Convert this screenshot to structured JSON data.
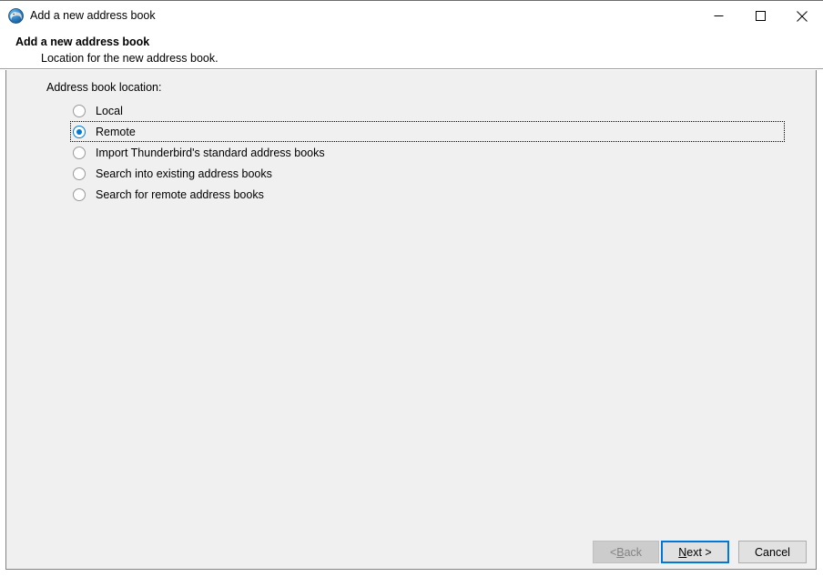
{
  "window": {
    "title": "Add a new address book",
    "icon": "thunderbird-icon",
    "controls": {
      "minimize": "minimize-icon",
      "maximize": "maximize-icon",
      "close": "close-icon"
    }
  },
  "header": {
    "title": "Add a new address book",
    "subtitle": "Location for the new address book."
  },
  "content": {
    "section_label": "Address book location:",
    "options": [
      {
        "label": "Local",
        "checked": false,
        "focused": false
      },
      {
        "label": "Remote",
        "checked": true,
        "focused": true
      },
      {
        "label": "Import Thunderbird's standard address books",
        "checked": false,
        "focused": false
      },
      {
        "label": "Search into existing address books",
        "checked": false,
        "focused": false
      },
      {
        "label": "Search for remote address books",
        "checked": false,
        "focused": false
      }
    ]
  },
  "footer": {
    "back": {
      "prefix": "< ",
      "accel": "B",
      "suffix": "ack",
      "enabled": false
    },
    "next": {
      "prefix": "",
      "accel": "N",
      "suffix": "ext >",
      "enabled": true,
      "default": true
    },
    "cancel": {
      "label": "Cancel",
      "enabled": true
    }
  },
  "colors": {
    "accent": "#0078d7",
    "panel_bg": "#f0f0f0",
    "button_bg": "#e1e1e1",
    "button_disabled_bg": "#cccccc",
    "border": "#828282"
  }
}
